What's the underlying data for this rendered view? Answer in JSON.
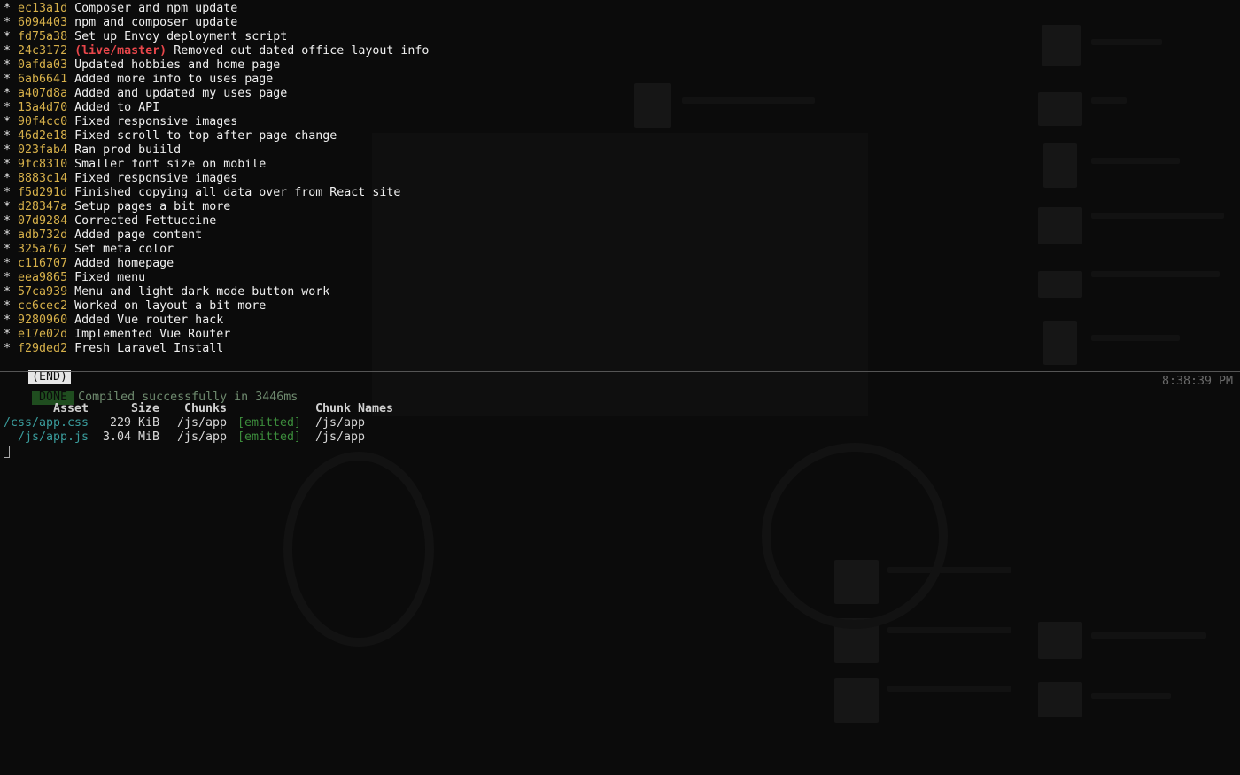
{
  "git_log": {
    "commits": [
      {
        "hash": "ec13a1d",
        "ref": "",
        "message": "Composer and npm update"
      },
      {
        "hash": "6094403",
        "ref": "",
        "message": "npm and composer update"
      },
      {
        "hash": "fd75a38",
        "ref": "",
        "message": "Set up Envoy deployment script"
      },
      {
        "hash": "24c3172",
        "ref": "(live/master)",
        "message": "Removed out dated office layout info"
      },
      {
        "hash": "0afda03",
        "ref": "",
        "message": "Updated hobbies and home page"
      },
      {
        "hash": "6ab6641",
        "ref": "",
        "message": "Added more info to uses page"
      },
      {
        "hash": "a407d8a",
        "ref": "",
        "message": "Added and updated my uses page"
      },
      {
        "hash": "13a4d70",
        "ref": "",
        "message": "Added to API"
      },
      {
        "hash": "90f4cc0",
        "ref": "",
        "message": "Fixed responsive images"
      },
      {
        "hash": "46d2e18",
        "ref": "",
        "message": "Fixed scroll to top after page change"
      },
      {
        "hash": "023fab4",
        "ref": "",
        "message": "Ran prod buiild"
      },
      {
        "hash": "9fc8310",
        "ref": "",
        "message": "Smaller font size on mobile"
      },
      {
        "hash": "8883c14",
        "ref": "",
        "message": "Fixed responsive images"
      },
      {
        "hash": "f5d291d",
        "ref": "",
        "message": "Finished copying all data over from React site"
      },
      {
        "hash": "d28347a",
        "ref": "",
        "message": "Setup pages a bit more"
      },
      {
        "hash": "07d9284",
        "ref": "",
        "message": "Corrected Fettuccine"
      },
      {
        "hash": "adb732d",
        "ref": "",
        "message": "Added page content"
      },
      {
        "hash": "325a767",
        "ref": "",
        "message": "Set meta color"
      },
      {
        "hash": "c116707",
        "ref": "",
        "message": "Added homepage"
      },
      {
        "hash": "eea9865",
        "ref": "",
        "message": "Fixed menu"
      },
      {
        "hash": "57ca939",
        "ref": "",
        "message": "Menu and light dark mode button work"
      },
      {
        "hash": "cc6cec2",
        "ref": "",
        "message": "Worked on layout a bit more"
      },
      {
        "hash": "9280960",
        "ref": "",
        "message": "Added Vue router hack"
      },
      {
        "hash": "e17e02d",
        "ref": "",
        "message": "Implemented Vue Router"
      },
      {
        "hash": "f29ded2",
        "ref": "",
        "message": "Fresh Laravel Install"
      }
    ],
    "bullet": "*",
    "end_marker": "(END)"
  },
  "build": {
    "status_badge": "DONE",
    "status_text": "Compiled successfully in 3446ms",
    "timestamp": "8:38:39 PM",
    "table": {
      "headers": {
        "asset": "Asset",
        "size": "Size",
        "chunks": "Chunks",
        "chunk_names": "Chunk Names"
      },
      "rows": [
        {
          "asset": "/css/app.css",
          "size": "229 KiB",
          "chunks": "/js/app",
          "emitted": "[emitted]",
          "chunk_names": "/js/app"
        },
        {
          "asset": "/js/app.js",
          "size": "3.04 MiB",
          "chunks": "/js/app",
          "emitted": "[emitted]",
          "chunk_names": "/js/app"
        }
      ]
    }
  },
  "colors": {
    "background": "#0b0b0b",
    "hash": "#d6b04a",
    "ref": "#e8464a",
    "asset": "#3a9c9c",
    "emitted": "#3c8d3c",
    "done_badge": "#1f4d1f"
  }
}
